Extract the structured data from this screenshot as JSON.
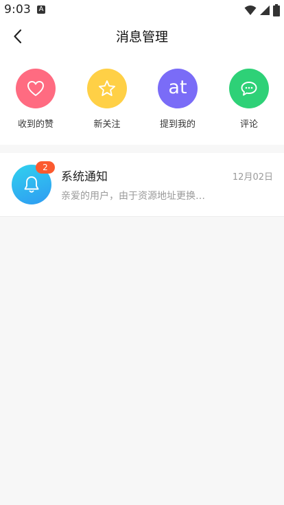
{
  "status_bar": {
    "time": "9:03",
    "notification_letter": "A",
    "icons": [
      "wifi-icon",
      "signal-icon",
      "battery-icon"
    ]
  },
  "nav": {
    "title": "消息管理",
    "back_icon": "chevron-left-icon"
  },
  "quick_actions": [
    {
      "label": "收到的赞",
      "icon": "heart-icon",
      "color": "#ff6b81"
    },
    {
      "label": "新关注",
      "icon": "star-icon",
      "color": "#ffd046"
    },
    {
      "label": "提到我的",
      "icon": "at-icon",
      "icon_text": "at",
      "color": "#7a6cf7"
    },
    {
      "label": "评论",
      "icon": "chat-bubble-icon",
      "color": "#2ed177"
    }
  ],
  "messages": [
    {
      "title": "系统通知",
      "badge": "2",
      "date": "12月02日",
      "preview": "亲爱的用户，由于资源地址更换…",
      "icon": "bell-icon",
      "colors": [
        "#30d1ee",
        "#2f9bf2"
      ],
      "badge_color": "#fb5a2f"
    }
  ]
}
